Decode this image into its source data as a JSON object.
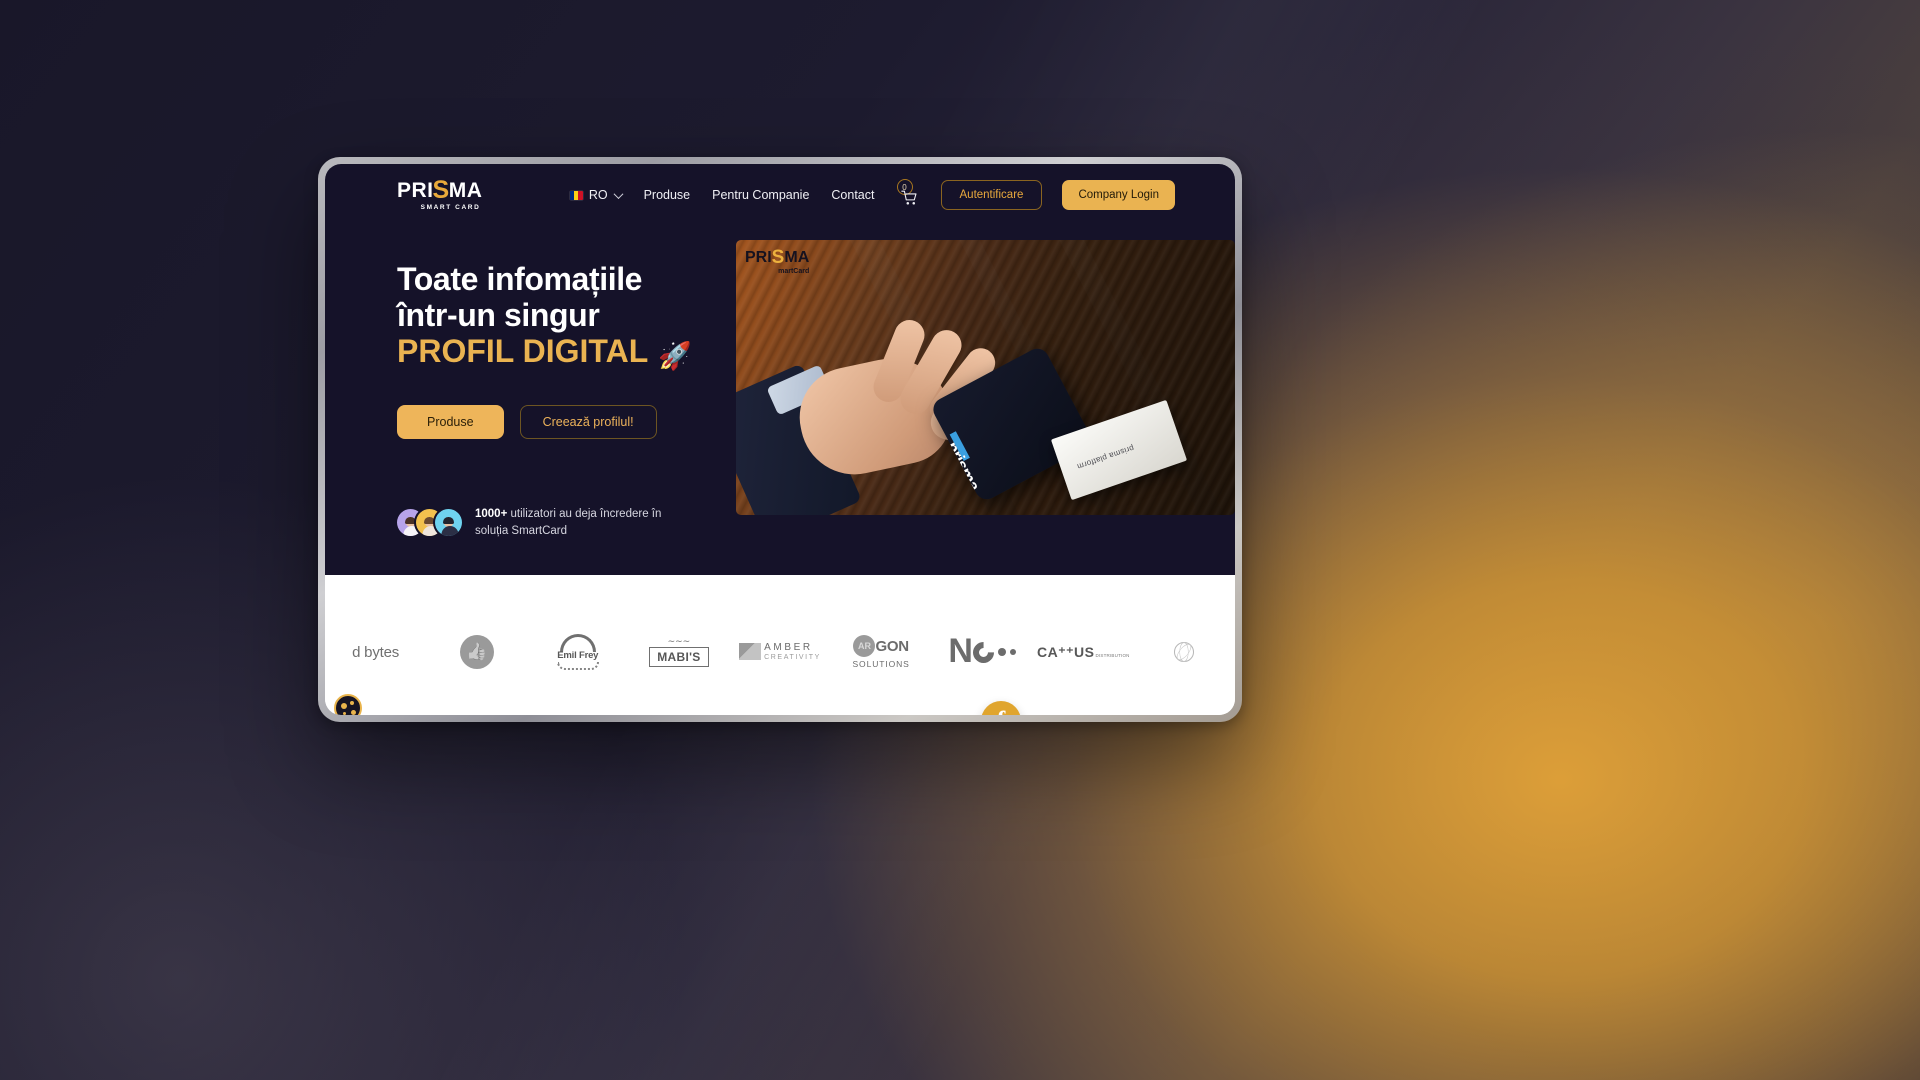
{
  "brand": {
    "accent": "#eab351",
    "dark": "#151229",
    "logo_main": "PRI",
    "logo_s": "S",
    "logo_main_end": "MA",
    "logo_sub": "SMART CARD"
  },
  "nav": {
    "language": {
      "code": "RO",
      "flag_colors": [
        "#002B7F",
        "#FCD116",
        "#CE1126"
      ]
    },
    "links": [
      {
        "label": "Produse",
        "name": "nav-link-produse"
      },
      {
        "label": "Pentru Companie",
        "name": "nav-link-pentru-companie"
      },
      {
        "label": "Contact",
        "name": "nav-link-contact"
      }
    ],
    "cart": {
      "count": "0",
      "icon": "shopping-cart-icon"
    },
    "buttons": {
      "login": "Autentificare",
      "company": "Company Login"
    }
  },
  "hero": {
    "headline_line1": "Toate infomațiile",
    "headline_line2": "într-un singur",
    "headline_line3": "PROFIL DIGITAL",
    "rocket": "🚀",
    "cta_primary": "Produse",
    "cta_secondary": "Creează profilul!",
    "social_proof": {
      "count": "1000+",
      "text": " utilizatori au deja încredere în soluția SmartCard",
      "avatar_colors": [
        "#b7a4ea",
        "#f2c14e",
        "#6fd3ef"
      ]
    },
    "image": {
      "watermark_main": "PRI",
      "watermark_s": "S",
      "watermark_end": "MA",
      "watermark_sub": "martCard",
      "phone_screen_text": "prisma",
      "card_text": "prisma platform",
      "alt": "hand-holding-phone-on-wooden-table"
    }
  },
  "partners": [
    {
      "name": "partner-logo-bytes",
      "label": "d bytes"
    },
    {
      "name": "partner-logo-thumb",
      "label": ""
    },
    {
      "name": "partner-logo-emil-frey",
      "label": "Emil Frey"
    },
    {
      "name": "partner-logo-mabis",
      "label": "MABI'S"
    },
    {
      "name": "partner-logo-amber",
      "label": "AMBER",
      "sublabel": "CREATIVITY"
    },
    {
      "name": "partner-logo-argon",
      "label": "GON",
      "badge": "AR",
      "sublabel": "SOLUTIONS"
    },
    {
      "name": "partner-logo-nc",
      "label": "N"
    },
    {
      "name": "partner-logo-cactus",
      "label": "CA⁺⁺US",
      "sublabel": "DISTRIBUTION"
    },
    {
      "name": "partner-logo-globe",
      "label": ""
    }
  ],
  "widgets": {
    "cookie": "cookie-consent-icon",
    "facebook": "f",
    "side_tab": "side-tab"
  }
}
